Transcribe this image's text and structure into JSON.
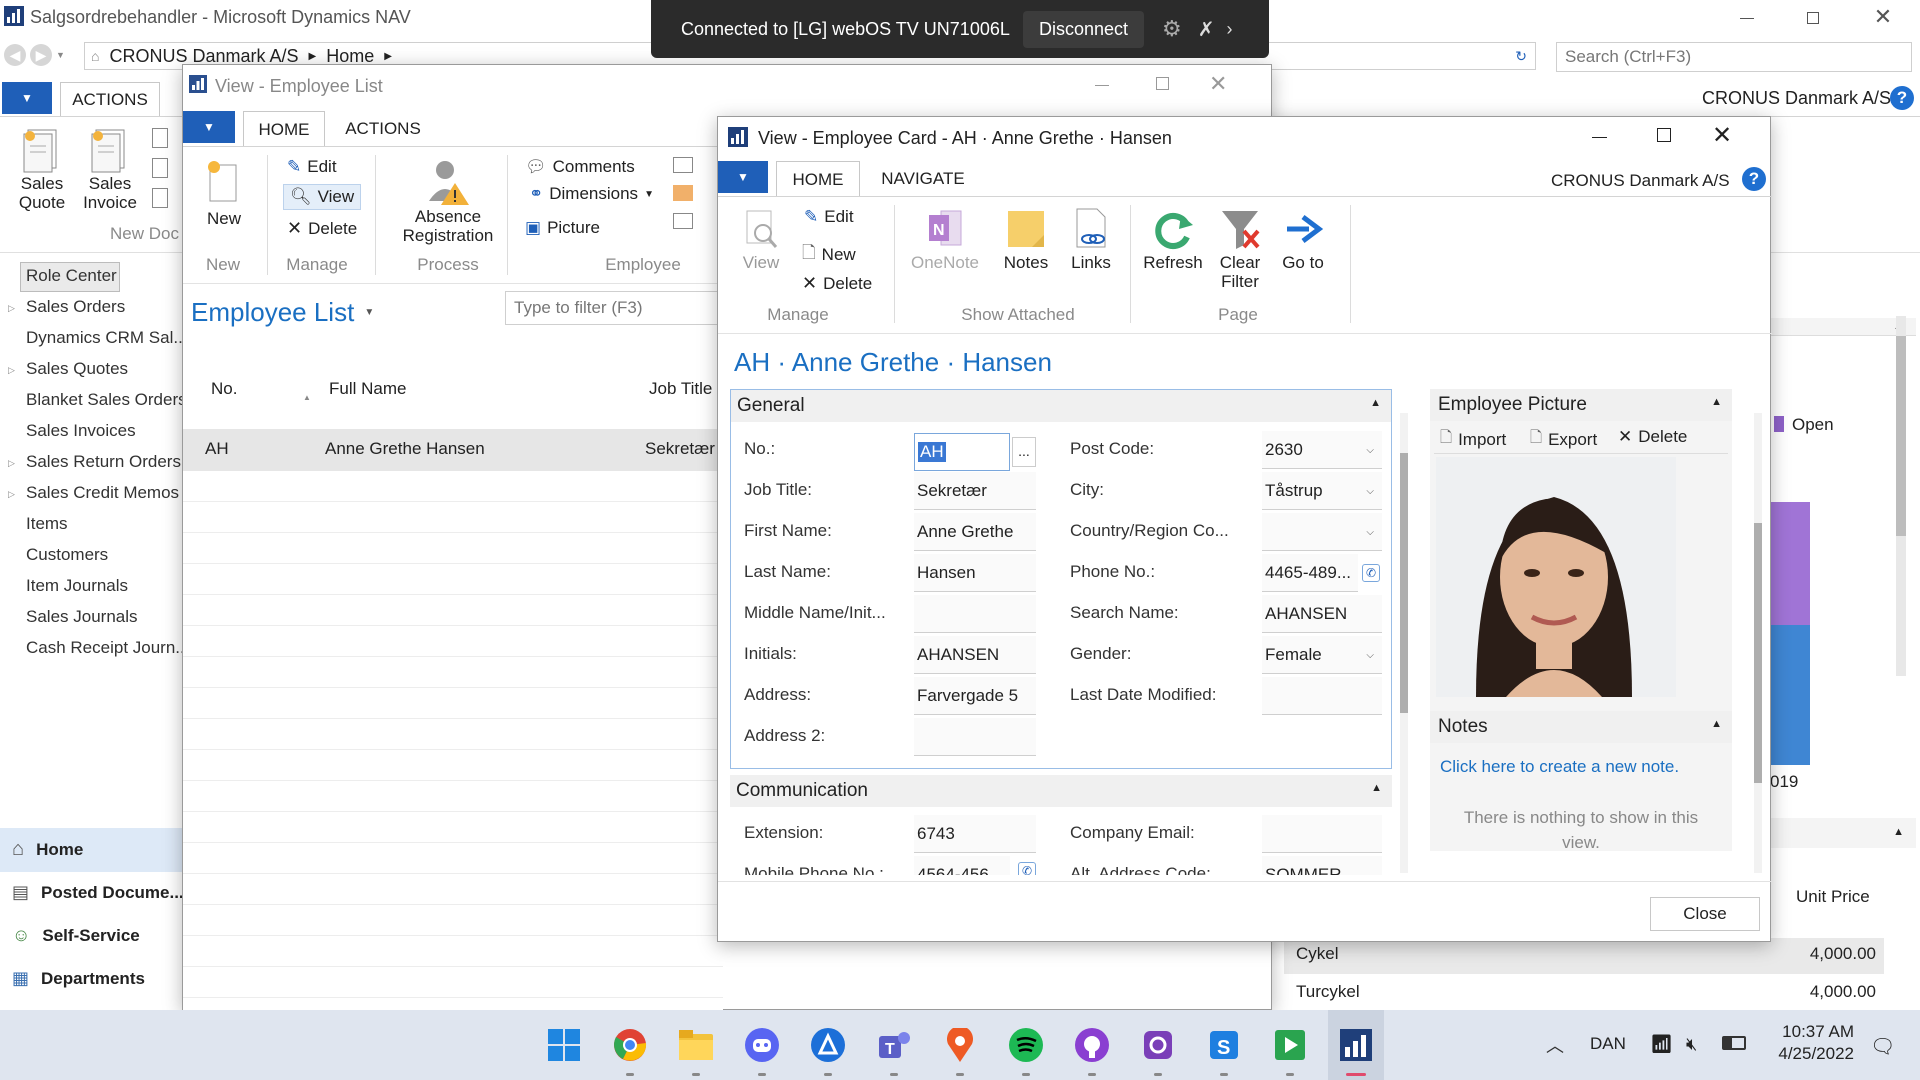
{
  "main": {
    "title": "Salgsordrebehandler - Microsoft Dynamics NAV",
    "breadcrumb": [
      "CRONUS Danmark A/S",
      "Home"
    ],
    "search_placeholder": "Search (Ctrl+F3)",
    "tab_actions": "ACTIONS",
    "company": "CRONUS Danmark A/S",
    "ribbon": {
      "sales_quote": "Sales Quote",
      "sales_invoice": "Sales Invoice",
      "new_doc_group": "New Doc"
    },
    "nav": [
      "Role Center",
      "Sales Orders",
      "Dynamics CRM Sal...",
      "Sales Quotes",
      "Blanket Sales Orders",
      "Sales Invoices",
      "Sales Return Orders",
      "Sales Credit Memos",
      "Items",
      "Customers",
      "Item Journals",
      "Sales Journals",
      "Cash Receipt Journ..."
    ],
    "bottom_nav": [
      "Home",
      "Posted Docume...",
      "Self-Service",
      "Departments"
    ],
    "right": {
      "open_legend": "Open",
      "year_tail": "019",
      "unit_price_header": "Unit Price",
      "rows": [
        {
          "name": "Cykel",
          "price": "4,000.00"
        },
        {
          "name": "Turcykel",
          "price": "4,000.00"
        }
      ]
    }
  },
  "cast": {
    "text": "Connected to [LG] webOS TV UN71006LE",
    "disconnect": "Disconnect"
  },
  "emp_list": {
    "title": "View - Employee List",
    "tab_home": "HOME",
    "tab_actions": "ACTIONS",
    "ribbon": {
      "new": "New",
      "edit": "Edit",
      "view": "View",
      "delete": "Delete",
      "absence": "Absence Registration",
      "comments": "Comments",
      "dimensions": "Dimensions",
      "picture": "Picture",
      "grp_new": "New",
      "grp_manage": "Manage",
      "grp_process": "Process",
      "grp_employee": "Employee"
    },
    "heading": "Employee List",
    "filter_placeholder": "Type to filter (F3)",
    "columns": [
      "No.",
      "Full Name",
      "Job Title"
    ],
    "rows": [
      {
        "no": "AH",
        "name": "Anne Grethe Hansen",
        "job": "Sekretær"
      }
    ]
  },
  "emp_card": {
    "title": "View - Employee Card - AH · Anne Grethe · Hansen",
    "tab_home": "HOME",
    "tab_navigate": "NAVIGATE",
    "company": "CRONUS Danmark A/S",
    "ribbon": {
      "view": "View",
      "edit": "Edit",
      "new": "New",
      "delete": "Delete",
      "onenote": "OneNote",
      "notes": "Notes",
      "links": "Links",
      "refresh": "Refresh",
      "clear_filter": "Clear Filter",
      "goto": "Go to",
      "grp_manage": "Manage",
      "grp_show": "Show Attached",
      "grp_page": "Page"
    },
    "heading": "AH · Anne Grethe · Hansen",
    "general": "General",
    "left_fields": [
      {
        "label": "No.:",
        "value": "AH"
      },
      {
        "label": "Job Title:",
        "value": "Sekretær"
      },
      {
        "label": "First Name:",
        "value": "Anne Grethe"
      },
      {
        "label": "Last Name:",
        "value": "Hansen"
      },
      {
        "label": "Middle Name/Init...",
        "value": ""
      },
      {
        "label": "Initials:",
        "value": "AHANSEN"
      },
      {
        "label": "Address:",
        "value": "Farvergade 5"
      },
      {
        "label": "Address 2:",
        "value": ""
      }
    ],
    "right_fields": [
      {
        "label": "Post Code:",
        "value": "2630"
      },
      {
        "label": "City:",
        "value": "Tåstrup"
      },
      {
        "label": "Country/Region Co...",
        "value": ""
      },
      {
        "label": "Phone No.:",
        "value": "4465-489..."
      },
      {
        "label": "Search Name:",
        "value": "AHANSEN"
      },
      {
        "label": "Gender:",
        "value": "Female"
      },
      {
        "label": "Last Date Modified:",
        "value": ""
      }
    ],
    "communication": "Communication",
    "comm_fields": {
      "extension_label": "Extension:",
      "extension": "6743",
      "mobile_label": "Mobile Phone No.:",
      "mobile": "4564-456",
      "email_label": "Company Email:",
      "email": "",
      "alt_label": "Alt. Address Code:",
      "alt": "SOMMER"
    },
    "picture": {
      "title": "Employee Picture",
      "import": "Import",
      "export": "Export",
      "delete": "Delete"
    },
    "notes": {
      "title": "Notes",
      "link": "Click here to create a new note.",
      "empty": "There is nothing to show in this view."
    },
    "close": "Close"
  },
  "taskbar": {
    "lang": "DAN",
    "time": "10:37 AM",
    "date": "4/25/2022"
  },
  "colors": {
    "accent": "#1f5fb8",
    "link": "#1a6fc2"
  }
}
